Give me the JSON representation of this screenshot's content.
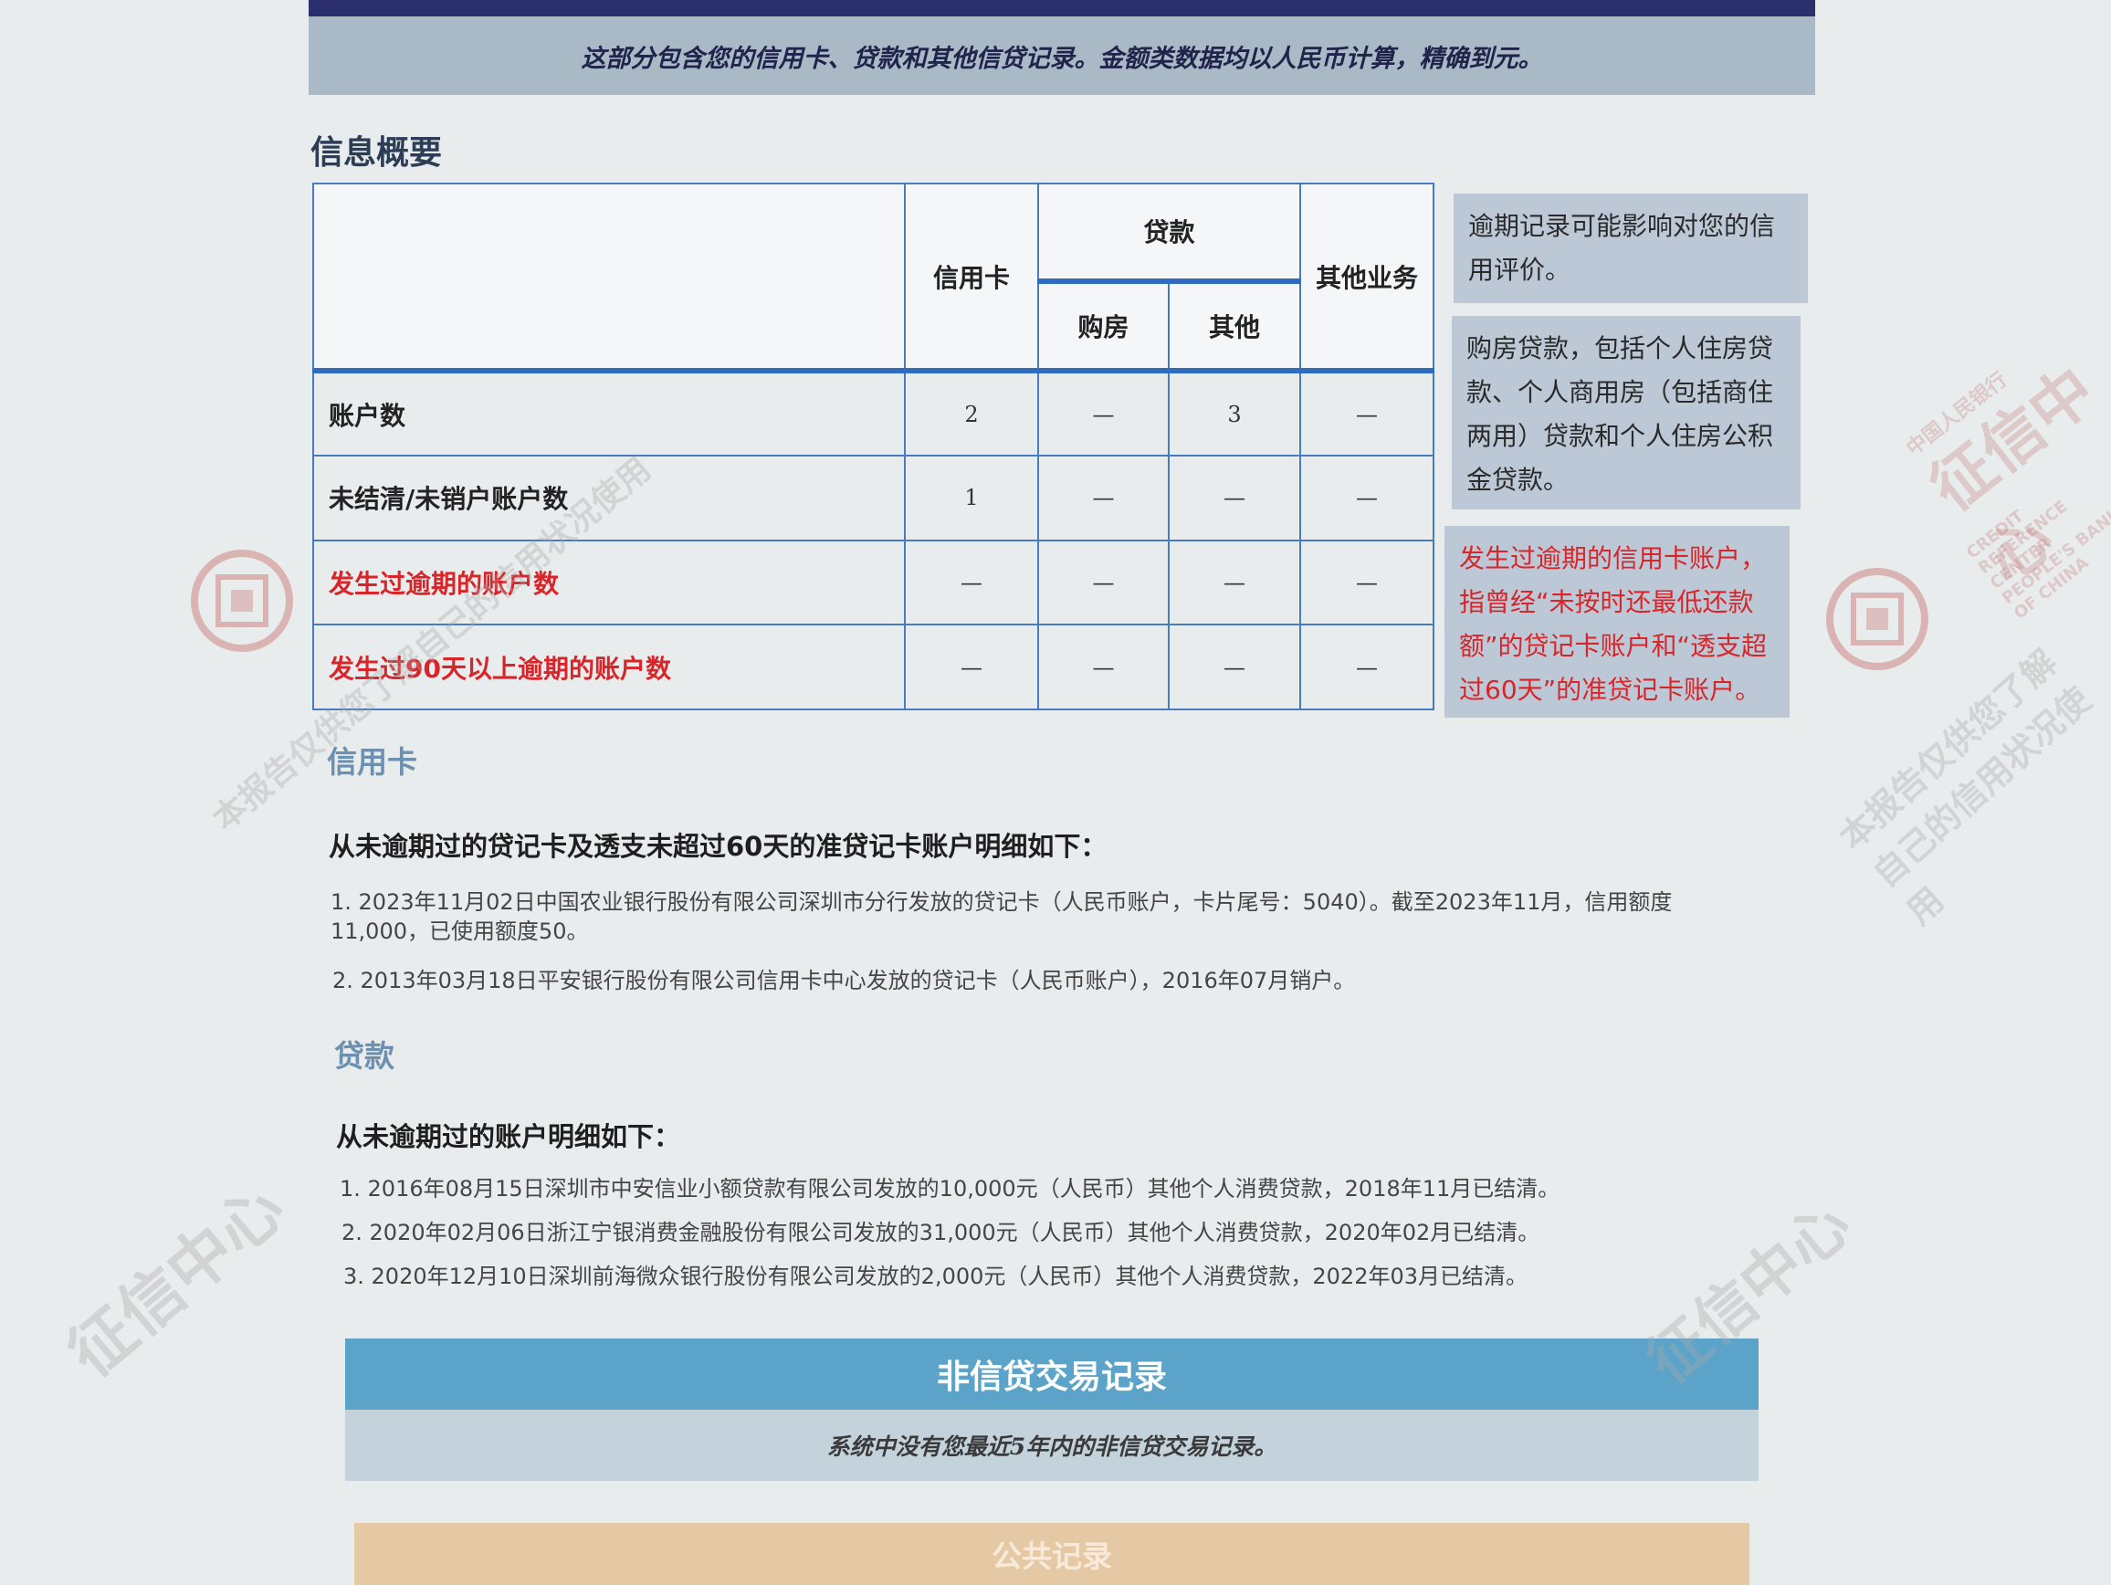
{
  "header": {
    "notice": "这部分包含您的信用卡、贷款和其他信贷记录。金额类数据均以人民币计算，精确到元。"
  },
  "summary": {
    "title": "信息概要",
    "columns": {
      "credit_card": "信用卡",
      "loan": "贷款",
      "loan_housing": "购房",
      "loan_other": "其他",
      "other_business": "其他业务"
    },
    "rows": [
      {
        "label": "账户数",
        "values": [
          "2",
          "—",
          "3",
          "—"
        ]
      },
      {
        "label": "未结清/未销户账户数",
        "values": [
          "1",
          "—",
          "—",
          "—"
        ]
      },
      {
        "label": "发生过逾期的账户数",
        "values": [
          "—",
          "—",
          "—",
          "—"
        ]
      },
      {
        "label": "发生过90天以上逾期的账户数",
        "values": [
          "—",
          "—",
          "—",
          "—"
        ]
      }
    ]
  },
  "notes": {
    "overdue_impact": "逾期记录可能影响对您的信用评价。",
    "housing_loan": "购房贷款，包括个人住房贷款、个人商用房（包括商住两用）贷款和个人住房公积金贷款。",
    "overdue_card_definition": "发生过逾期的信用卡账户，指曾经“未按时还最低还款额”的贷记卡账户和“透支超过60天”的准贷记卡账户。"
  },
  "credit_card_section": {
    "title": "信用卡",
    "heading": "从未逾期过的贷记卡及透支未超过60天的准贷记卡账户明细如下：",
    "items": [
      "1. 2023年11月02日中国农业银行股份有限公司深圳市分行发放的贷记卡（人民币账户，卡片尾号：5040）。截至2023年11月，信用额度11,000，已使用额度50。",
      "2. 2013年03月18日平安银行股份有限公司信用卡中心发放的贷记卡（人民币账户），2016年07月销户。"
    ]
  },
  "loan_section": {
    "title": "贷款",
    "heading": "从未逾期过的账户明细如下：",
    "items": [
      "1. 2016年08月15日深圳市中安信业小额贷款有限公司发放的10,000元（人民币）其他个人消费贷款，2018年11月已结清。",
      "2. 2020年02月06日浙江宁银消费金融股份有限公司发放的31,000元（人民币）其他个人消费贷款，2020年02月已结清。",
      "3. 2020年12月10日深圳前海微众银行股份有限公司发放的2,000元（人民币）其他个人消费贷款，2022年03月已结清。"
    ]
  },
  "non_credit": {
    "title": "非信贷交易记录",
    "message": "系统中没有您最近5年内的非信贷交易记录。"
  },
  "public_record": {
    "title": "公共记录"
  },
  "watermarks": {
    "center": "征信中心",
    "english": "CREDIT REFERENCE CENTER PEOPLE'S BANK OF CHINA",
    "bank": "中国人民银行",
    "slogan": "本报告仅供您了解自己的信用状况使用"
  },
  "colors": {
    "table_border": "#4a7bbf",
    "alert_red": "#d8252a",
    "note_bg": "#bcc8d6",
    "noncredit_banner": "#5ba3c8",
    "public_banner": "#e5c9a4"
  }
}
